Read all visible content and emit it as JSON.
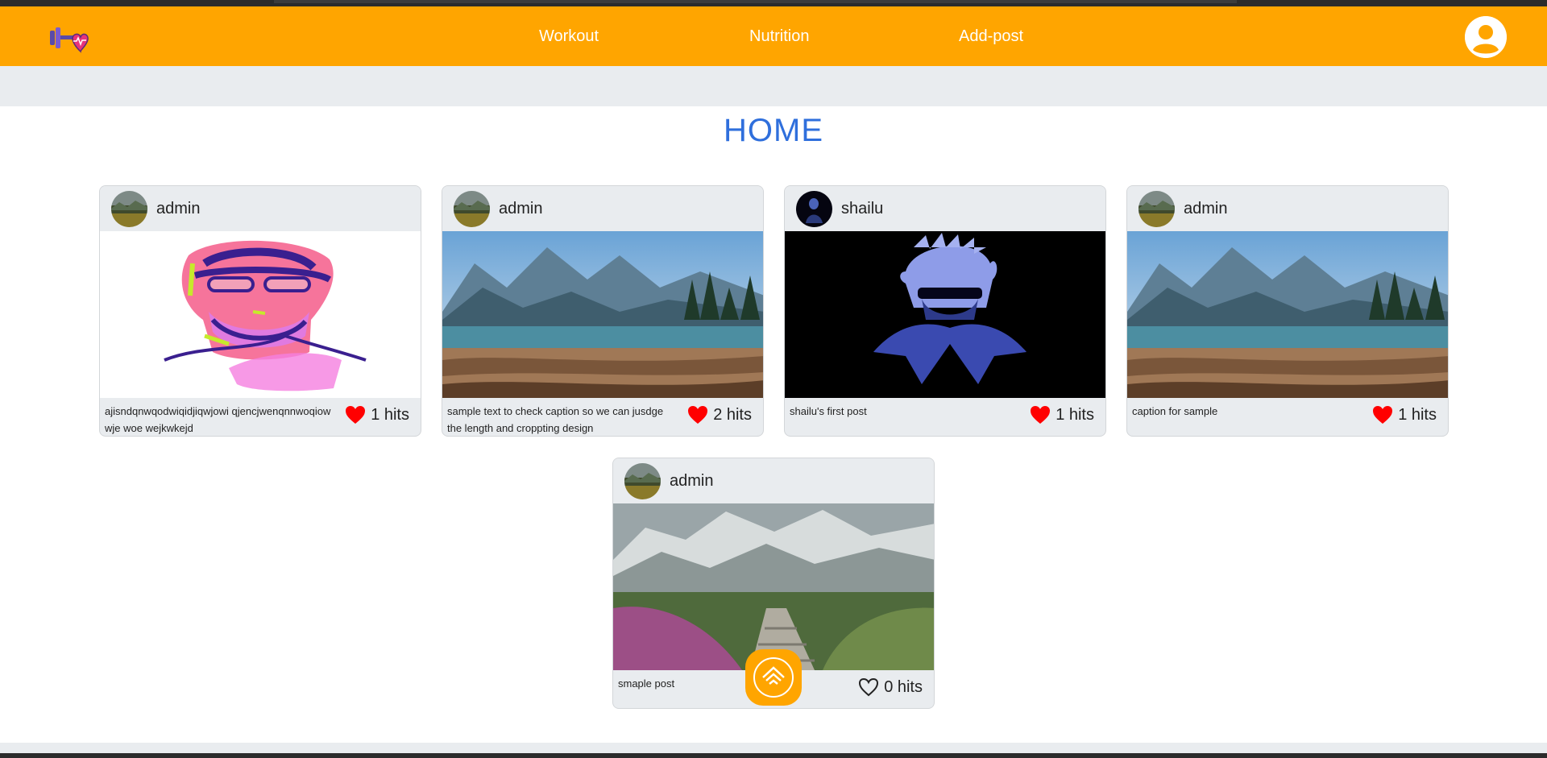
{
  "nav": {
    "links": [
      "Workout",
      "Nutrition",
      "Add-post"
    ],
    "logo_icon": "dumbbell-heart-logo-icon",
    "profile_icon": "user-circle-icon"
  },
  "page": {
    "title": "HOME"
  },
  "posts": [
    {
      "user": "admin",
      "caption": "ajisndqnwqodwiqidjiqwjowi qjencjwenqnnwoqiow wje woe wejkwkejd",
      "hits": "1 hits",
      "liked": true,
      "image": "face-sketch-illustration"
    },
    {
      "user": "admin",
      "caption": "sample text to check caption so we can jusdge the length and croppting design",
      "hits": "2 hits",
      "liked": true,
      "image": "mountain-lake-photo"
    },
    {
      "user": "shailu",
      "caption": "shailu's first post",
      "hits": "1 hits",
      "liked": true,
      "image": "anime-character-dark-photo"
    },
    {
      "user": "admin",
      "caption": "caption for sample",
      "hits": "1 hits",
      "liked": true,
      "image": "mountain-lake-photo"
    },
    {
      "user": "admin",
      "caption": "smaple post",
      "hits": "0 hits",
      "liked": false,
      "image": "mountain-path-flowers-photo"
    }
  ],
  "fab": {
    "icon": "home-layers-icon"
  },
  "colors": {
    "brand": "#ffa500",
    "title": "#2f6fdc",
    "heart": "#ff0000"
  }
}
